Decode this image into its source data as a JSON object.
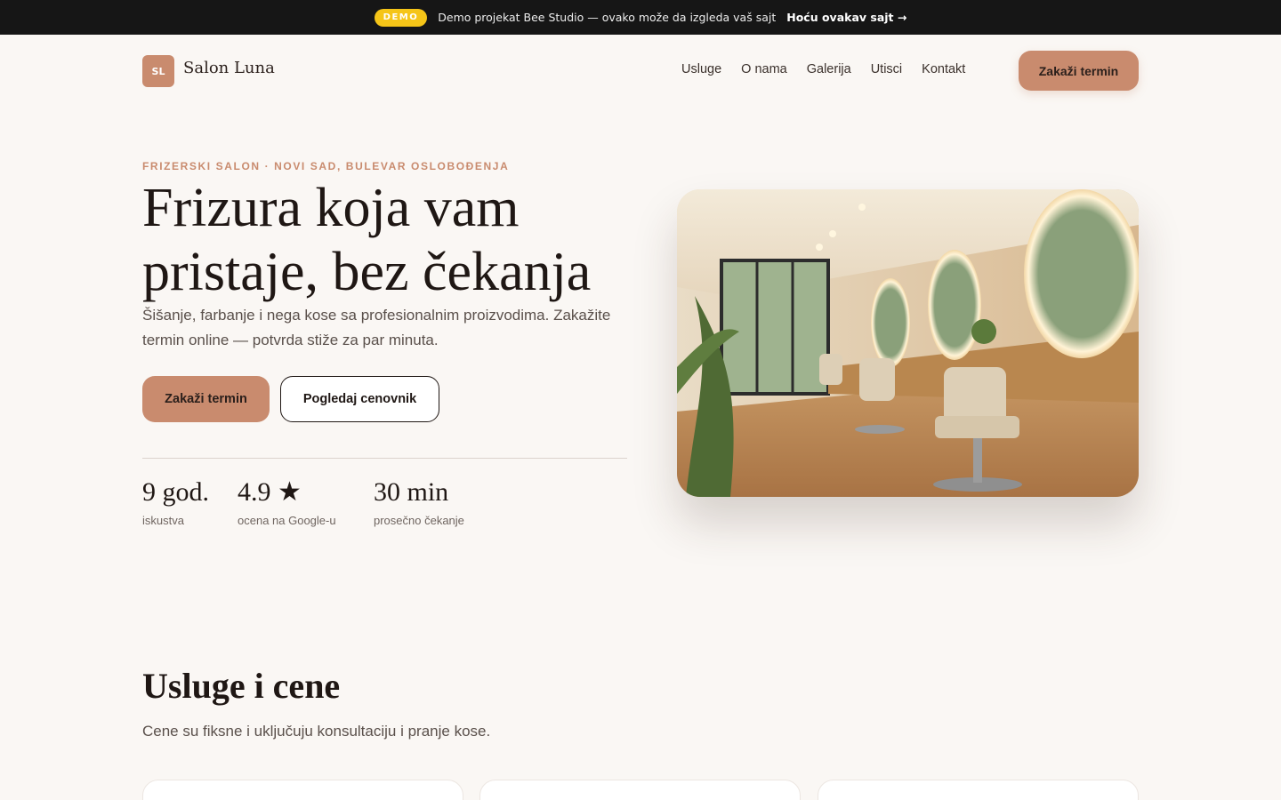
{
  "demo_bar": {
    "badge": "DEMO",
    "text": "Demo projekat Bee Studio — ovako može da izgleda vaš sajt",
    "link": "Hoću ovakav sajt →"
  },
  "header": {
    "logo_initials": "SL",
    "brand": "Salon Luna",
    "nav": [
      "Usluge",
      "O nama",
      "Galerija",
      "Utisci",
      "Kontakt"
    ],
    "cta": "Zakaži termin"
  },
  "hero": {
    "eyebrow": "FRIZERSKI SALON · NOVI SAD, BULEVAR OSLOBOĐENJA",
    "title": "Frizura koja vam pristaje, bez čekanja",
    "subtitle": "Šišanje, farbanje i nega kose sa profesionalnim proizvodima. Zakažite termin online — potvrda stiže za par minuta.",
    "primary_button": "Zakaži termin",
    "secondary_button": "Pogledaj cenovnik",
    "stats": [
      {
        "value": "9 god.",
        "label": "iskustva"
      },
      {
        "value": "4.9 ★",
        "label": "ocena na Google-u"
      },
      {
        "value": "30 min",
        "label": "prosečno čekanje"
      }
    ]
  },
  "services": {
    "title": "Usluge i cene",
    "subtitle": "Cene su fiksne i uključuju konsultaciju i pranje kose."
  },
  "colors": {
    "accent": "#c98b6e",
    "background": "#faf7f4",
    "demo_bar": "#161616",
    "demo_badge": "#f5c518"
  }
}
